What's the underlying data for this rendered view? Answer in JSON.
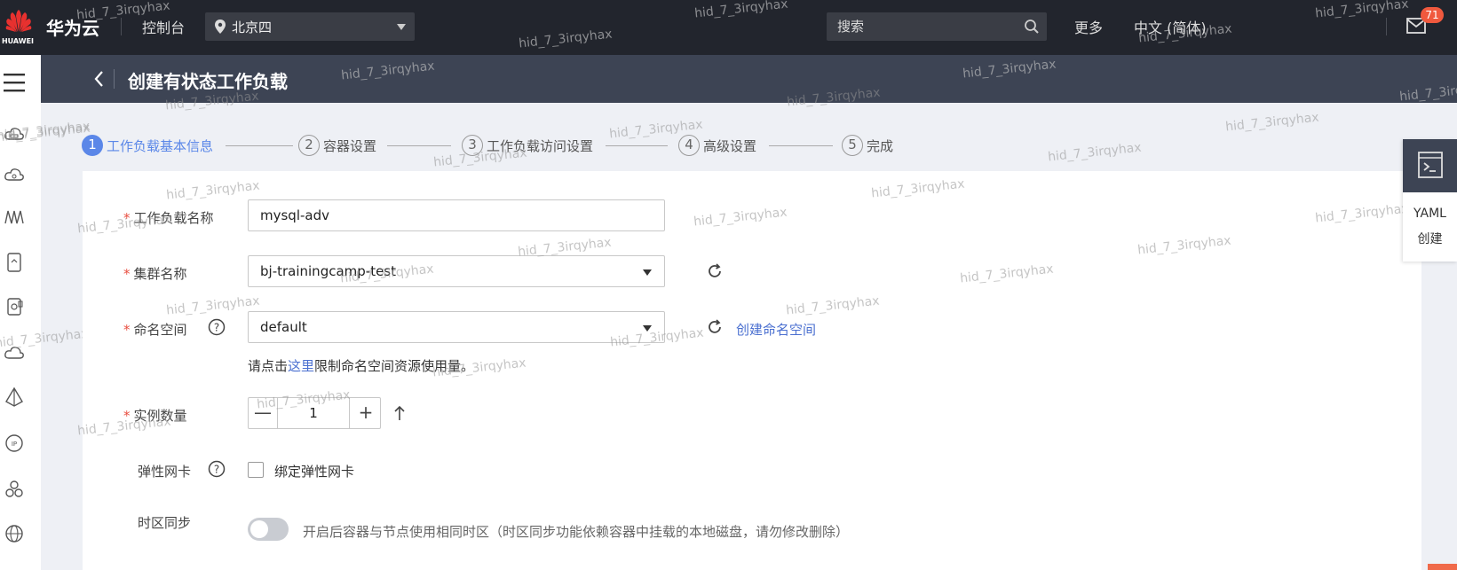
{
  "topbar": {
    "logo_text": "HUAWEI",
    "brand": "华为云",
    "console": "控制台",
    "region": "北京四",
    "search_placeholder": "搜索",
    "more": "更多",
    "language": "中文 (简体)",
    "notification_count": "71"
  },
  "page": {
    "title": "创建有状态工作负载"
  },
  "steps": [
    {
      "num": "1",
      "label": "工作负载基本信息"
    },
    {
      "num": "2",
      "label": "容器设置"
    },
    {
      "num": "3",
      "label": "工作负载访问设置"
    },
    {
      "num": "4",
      "label": "高级设置"
    },
    {
      "num": "5",
      "label": "完成"
    }
  ],
  "form": {
    "required_mark": "*",
    "workload_name": {
      "label": "工作负载名称",
      "value": "mysql-adv"
    },
    "cluster": {
      "label": "集群名称",
      "value": "bj-trainingcamp-test"
    },
    "namespace": {
      "label": "命名空间",
      "value": "default",
      "create_link": "创建命名空间",
      "hint_prefix": "请点击",
      "hint_link": "这里",
      "hint_suffix": "限制命名空间资源使用量。"
    },
    "instances": {
      "label": "实例数量",
      "value": "1",
      "minus": "—",
      "plus": "+"
    },
    "eni": {
      "label": "弹性网卡",
      "checkbox_label": "绑定弹性网卡"
    },
    "timezone": {
      "label": "时区同步",
      "description": "开启后容器与节点使用相同时区（时区同步功能依赖容器中挂载的本地磁盘，请勿修改删除）"
    }
  },
  "yaml_panel": {
    "line1": "YAML",
    "line2": "创建"
  },
  "watermark": "hid_7_3irqyhax"
}
